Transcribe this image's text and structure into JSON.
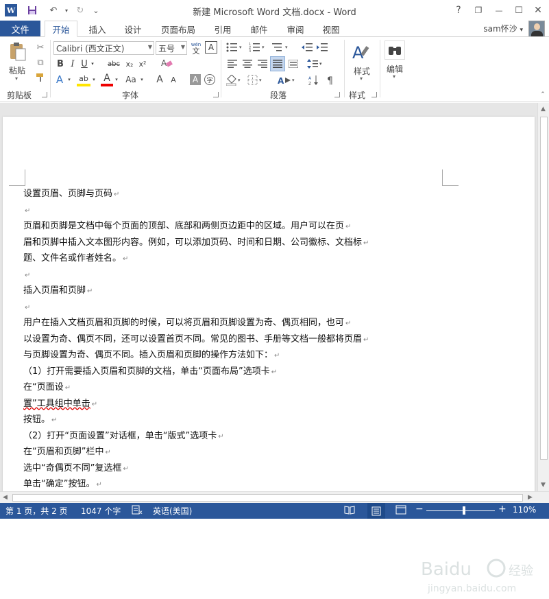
{
  "window": {
    "title": "新建 Microsoft Word 文档.docx - Word",
    "help": "?",
    "restore": "❐",
    "minimize": "—",
    "maximize": "☐",
    "close": "✕"
  },
  "qat": {
    "word_logo": "W",
    "save_icon": "save-icon",
    "undo_icon": "undo-icon",
    "redo_icon": "redo-icon",
    "customize": "⌄"
  },
  "tabs": {
    "file": "文件",
    "items": [
      "开始",
      "插入",
      "设计",
      "页面布局",
      "引用",
      "邮件",
      "审阅",
      "视图"
    ],
    "active_index": 0
  },
  "user": {
    "name": "sam怀沙",
    "dropdown": "▾"
  },
  "ribbon": {
    "clipboard": {
      "paste_label": "粘贴",
      "group_label": "剪贴板"
    },
    "font": {
      "font_name": "Calibri (西文正文)",
      "font_size": "五号",
      "wen_label": "wén",
      "wen_char": "文",
      "box_a": "A",
      "bold": "B",
      "italic": "I",
      "underline": "U",
      "strike": "abc",
      "subscript": "x₂",
      "superscript": "x²",
      "clear_format": "A",
      "text_effect": "A",
      "highlight": "ab",
      "font_color": "A",
      "change_case": "Aa",
      "grow": "A",
      "shrink": "A",
      "char_shading": "A",
      "enclose": "字",
      "group_label": "字体"
    },
    "paragraph": {
      "group_label": "段落"
    },
    "styles": {
      "label": "样式",
      "group_label": "样式"
    },
    "editing": {
      "label": "编辑"
    }
  },
  "document": {
    "paragraphs": [
      "设置页眉、页脚与页码",
      "",
      "页眉和页脚是文档中每个页面的顶部、底部和两侧页边距中的区域。用户可以在页",
      "眉和页脚中插入文本图形内容。例如，可以添加页码、时间和日期、公司徽标、文档标",
      "题、文件名或作者姓名。",
      "",
      "插入页眉和页脚",
      "",
      "用户在插入文档页眉和页脚的时候，可以将页眉和页脚设置为奇、偶页相同，也可",
      "以设置为奇、偶页不同，还可以设置首页不同。常见的图书、手册等文档一般都将页眉",
      "与页脚设置为奇、偶页不同。插入页眉和页脚的操作方法如下：",
      "（1）打开需要插入页眉和页脚的文档，单击“页面布局”选项卡",
      "在“页面设",
      "置”工具组中单击",
      "按钮。",
      "（2）打开“页面设置”对话框，单击“版式”选项卡",
      "在“页眉和页脚”栏中",
      "选中“奇偶页不同”复选框",
      "单击“确定”按钮。"
    ],
    "para_mark": "↵"
  },
  "status": {
    "page": "第 1 页，共 2 页",
    "words": "1047 个字",
    "language": "英语(美国)",
    "zoom_out": "−",
    "zoom_in": "+",
    "zoom_level": "110%",
    "zoom_fraction": 0.55
  },
  "watermark": {
    "brand": "Baidu 经验",
    "url": "jingyan.baidu.com"
  },
  "colors": {
    "accent": "#2b579a",
    "status_bg": "#2b579a"
  }
}
